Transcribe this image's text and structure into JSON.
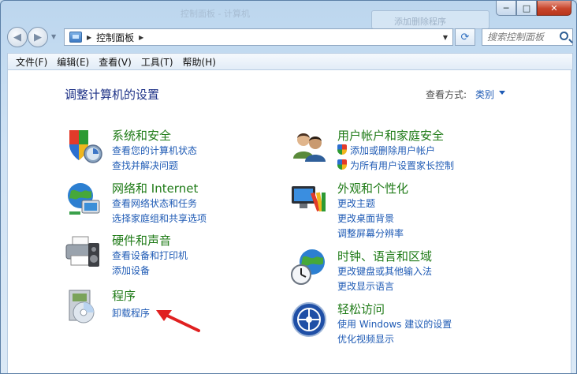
{
  "window": {
    "background_title": "控制面板 - 计算机",
    "ghost_window_text": "添加删除程序",
    "caption": {
      "minimize": "─",
      "maximize": "□",
      "close": "✕"
    }
  },
  "nav": {
    "back_icon": "arrow-left-icon",
    "forward_icon": "arrow-right-icon",
    "breadcrumb": [
      "控制面板"
    ],
    "search_placeholder": "搜索控制面板"
  },
  "menu": [
    "文件(F)",
    "编辑(E)",
    "查看(V)",
    "工具(T)",
    "帮助(H)"
  ],
  "main": {
    "title": "调整计算机的设置",
    "view_by_label": "查看方式:",
    "view_by_value": "类别"
  },
  "categories": [
    {
      "title": "系统和安全",
      "icon": "shield-monitor-icon",
      "links": [
        "查看您的计算机状态",
        "查找并解决问题"
      ]
    },
    {
      "title": "网络和 Internet",
      "icon": "network-globe-icon",
      "links": [
        "查看网络状态和任务",
        "选择家庭组和共享选项"
      ]
    },
    {
      "title": "硬件和声音",
      "icon": "printer-speaker-icon",
      "links": [
        "查看设备和打印机",
        "添加设备"
      ]
    },
    {
      "title": "程序",
      "icon": "programs-disc-icon",
      "links": [
        "卸载程序"
      ]
    },
    {
      "title": "用户帐户和家庭安全",
      "icon": "users-icon",
      "links": [
        "添加或删除用户帐户",
        "为所有用户设置家长控制"
      ]
    },
    {
      "title": "外观和个性化",
      "icon": "monitor-palette-icon",
      "links": [
        "更改主题",
        "更改桌面背景",
        "调整屏幕分辨率"
      ]
    },
    {
      "title": "时钟、语言和区域",
      "icon": "clock-globe-icon",
      "links": [
        "更改键盘或其他输入法",
        "更改显示语言"
      ]
    },
    {
      "title": "轻松访问",
      "icon": "ease-of-access-icon",
      "links": [
        "使用 Windows 建议的设置",
        "优化视频显示"
      ]
    }
  ],
  "colors": {
    "title_blue": "#1e3287",
    "category_green": "#1e7a16",
    "link_blue": "#1f5bb5",
    "annotation_red": "#e02020"
  }
}
